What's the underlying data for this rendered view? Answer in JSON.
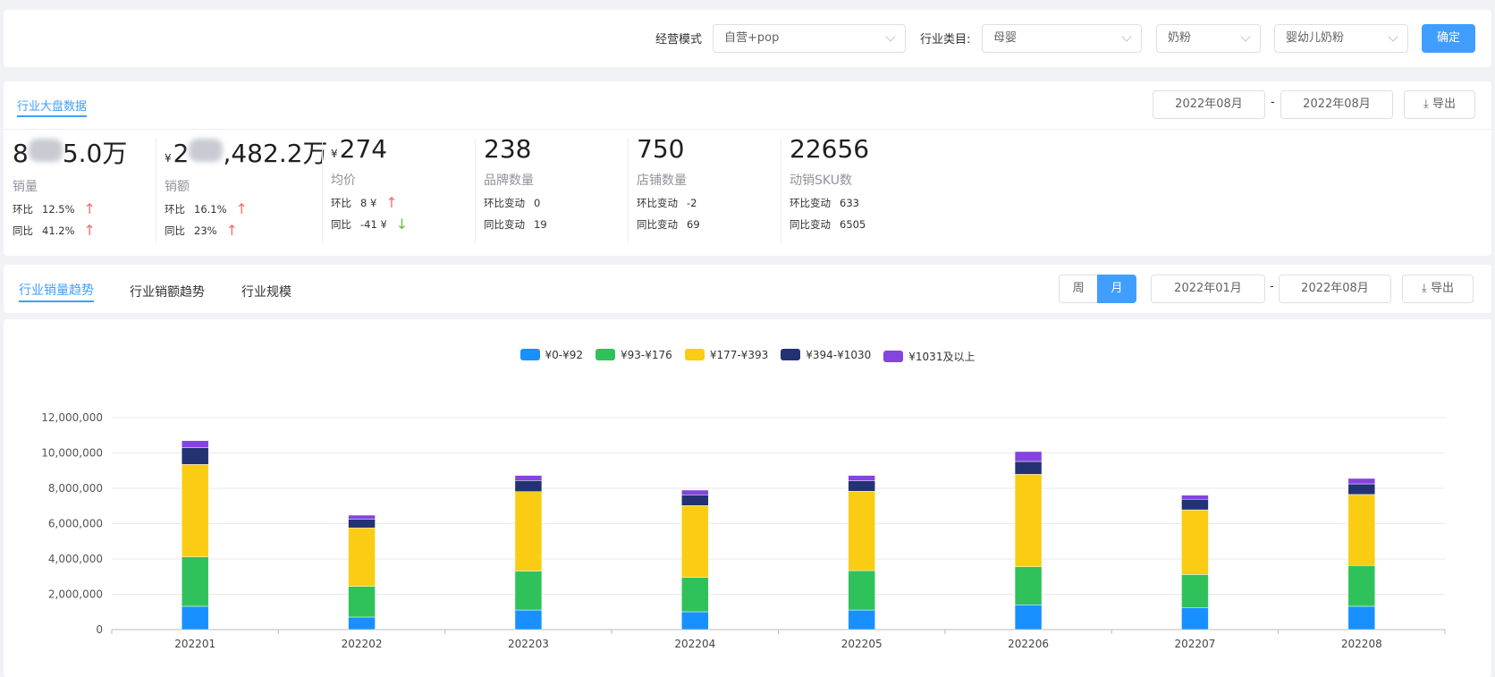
{
  "filters": {
    "mode_label": "经营模式",
    "mode_value": "自营+pop",
    "category_label": "行业类目:",
    "category_value": "母婴",
    "sub_value": "奶粉",
    "leaf_value": "婴幼儿奶粉",
    "confirm": "确定"
  },
  "overview": {
    "tab": "行业大盘数据",
    "date_start": "2022年08月",
    "date_end": "2022年08月",
    "sep": "-",
    "export": "导出",
    "stats": [
      {
        "currency": "",
        "prefix": "8",
        "suffix": "5.0万",
        "blurred": true,
        "label": "销量",
        "r1k": "环比",
        "r1v": "12.5%",
        "r1dir": "up",
        "r2k": "同比",
        "r2v": "41.2%",
        "r2dir": "up"
      },
      {
        "currency": "¥",
        "prefix": "2",
        "suffix": ",482.2万",
        "blurred": true,
        "label": "销额",
        "r1k": "环比",
        "r1v": "16.1%",
        "r1dir": "up",
        "r2k": "同比",
        "r2v": "23%",
        "r2dir": "up"
      },
      {
        "currency": "¥",
        "prefix": "274",
        "suffix": "",
        "blurred": false,
        "label": "均价",
        "r1k": "环比",
        "r1v": "8 ¥",
        "r1dir": "up",
        "r2k": "同比",
        "r2v": "-41 ¥",
        "r2dir": "down"
      },
      {
        "currency": "",
        "prefix": "238",
        "suffix": "",
        "blurred": false,
        "label": "品牌数量",
        "r1k": "环比变动",
        "r1v": "0",
        "r1dir": "",
        "r2k": "同比变动",
        "r2v": "19",
        "r2dir": ""
      },
      {
        "currency": "",
        "prefix": "750",
        "suffix": "",
        "blurred": false,
        "label": "店铺数量",
        "r1k": "环比变动",
        "r1v": "-2",
        "r1dir": "",
        "r2k": "同比变动",
        "r2v": "69",
        "r2dir": ""
      },
      {
        "currency": "",
        "prefix": "22656",
        "suffix": "",
        "blurred": false,
        "label": "动销SKU数",
        "r1k": "环比变动",
        "r1v": "633",
        "r1dir": "",
        "r2k": "同比变动",
        "r2v": "6505",
        "r2dir": ""
      }
    ]
  },
  "trend": {
    "tabs": [
      "行业销量趋势",
      "行业销额趋势",
      "行业规模"
    ],
    "active_tab": 0,
    "week": "周",
    "month": "月",
    "active_period": "月",
    "date_start": "2022年01月",
    "date_end": "2022年08月",
    "sep": "-",
    "export": "导出"
  },
  "chart_data": {
    "type": "bar",
    "stacked": true,
    "categories": [
      "202201",
      "202202",
      "202203",
      "202204",
      "202205",
      "202206",
      "202207",
      "202208"
    ],
    "ylim": [
      0,
      12000000
    ],
    "yticks": [
      "0",
      "2,000,000",
      "4,000,000",
      "6,000,000",
      "8,000,000",
      "10,000,000",
      "12,000,000"
    ],
    "grid": true,
    "legend": "top",
    "series": [
      {
        "name": "¥0-¥92",
        "color": "#1890ff",
        "values": [
          1320000,
          710000,
          1110000,
          1010000,
          1110000,
          1400000,
          1250000,
          1320000
        ]
      },
      {
        "name": "¥93-¥176",
        "color": "#2fc25b",
        "values": [
          2800000,
          1740000,
          2210000,
          1940000,
          2230000,
          2160000,
          1870000,
          2310000
        ]
      },
      {
        "name": "¥177-¥393",
        "color": "#facc14",
        "values": [
          5230000,
          3310000,
          4490000,
          4070000,
          4490000,
          5230000,
          3660000,
          4020000
        ]
      },
      {
        "name": "¥394-¥1030",
        "color": "#223273",
        "values": [
          960000,
          500000,
          630000,
          610000,
          590000,
          730000,
          600000,
          600000
        ]
      },
      {
        "name": "¥1031及以上",
        "color": "#8543e0",
        "values": [
          390000,
          220000,
          290000,
          270000,
          310000,
          560000,
          230000,
          310000
        ]
      }
    ]
  }
}
